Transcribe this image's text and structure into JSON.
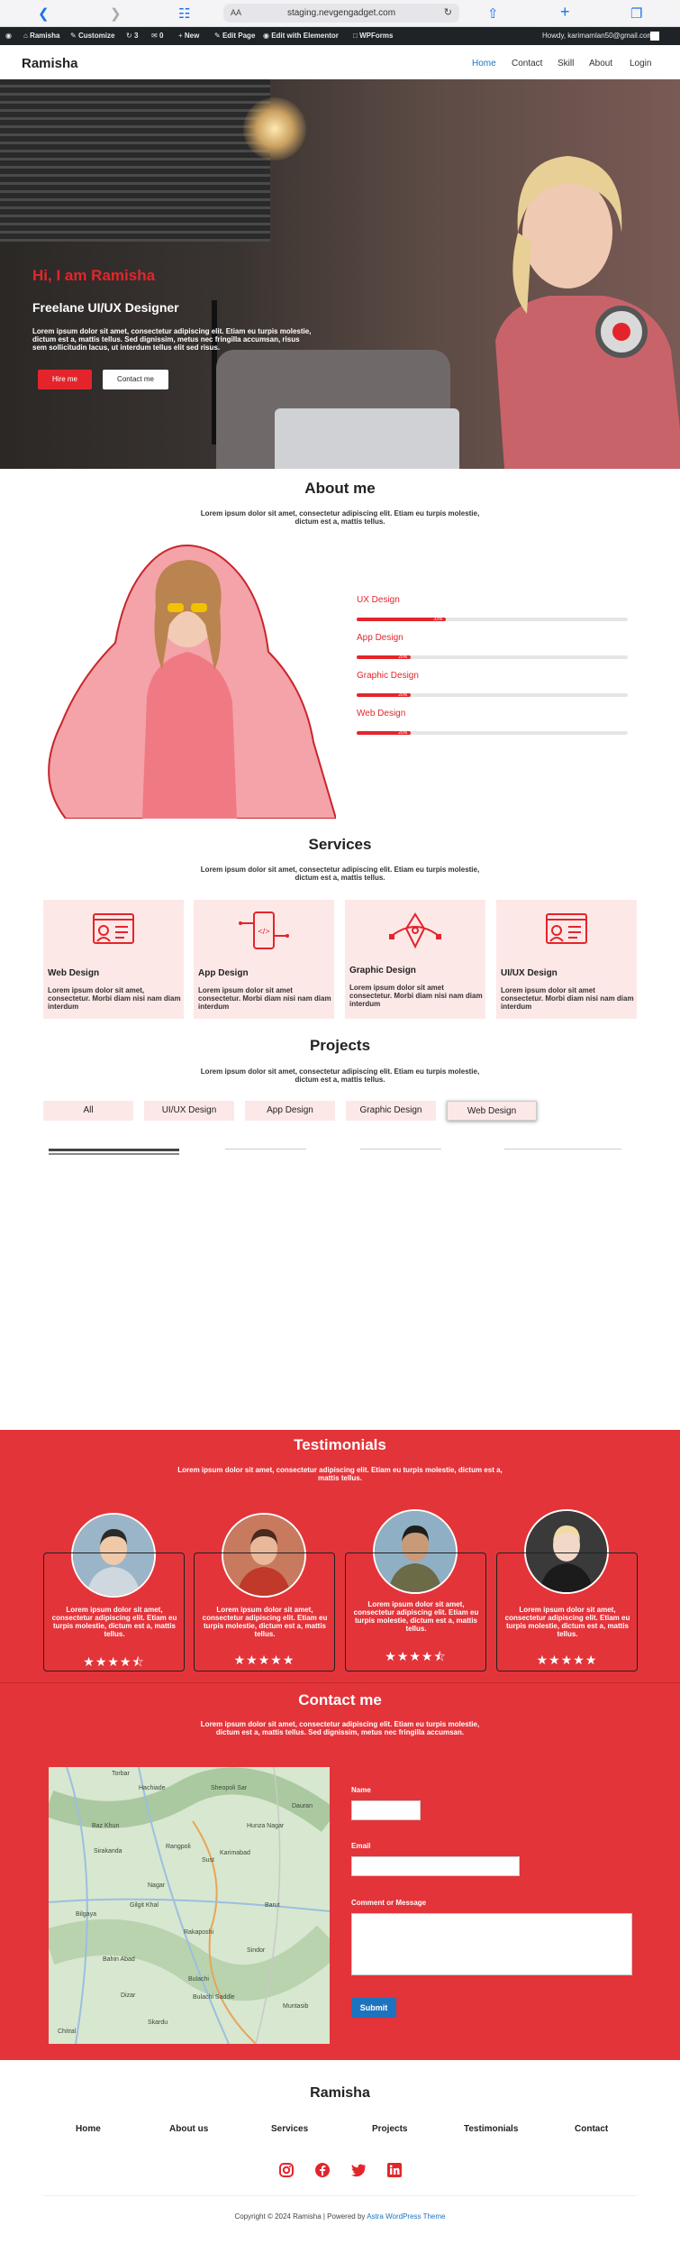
{
  "browser": {
    "url": "staging.nevgengadget.com",
    "aa_label": "AA"
  },
  "admin_bar": {
    "site_name": "Ramisha",
    "customize": "Customize",
    "updates": "3",
    "comments": "0",
    "new": "New",
    "edit_page": "Edit Page",
    "edit_elementor": "Edit with Elementor",
    "wpforms": "WPForms",
    "howdy": "Howdy, karimamlan50@gmail.com"
  },
  "header": {
    "logo": "Ramisha",
    "nav": [
      "Home",
      "Contact",
      "Skill",
      "About",
      "Login"
    ]
  },
  "hero": {
    "greeting": "Hi, I am Ramisha",
    "role": "Freelane UI/UX Designer",
    "description": "Lorem ipsum dolor sit amet, consectetur adipiscing elit. Etiam eu turpis molestie, dictum est a, mattis tellus. Sed dignissim, metus nec fringilla accumsan, risus sem sollicitudin lacus, ut interdum tellus elit sed risus.",
    "hire_button": "Hire me",
    "contact_button": "Contact me"
  },
  "about": {
    "title": "About me",
    "subtitle": "Lorem ipsum dolor sit amet, consectetur adipiscing elit. Etiam eu turpis molestie, dictum est a, mattis tellus.",
    "skills": [
      {
        "label": "UX Design",
        "percent": 33,
        "pct_text": "33%"
      },
      {
        "label": "App Design",
        "percent": 20,
        "pct_text": "20%"
      },
      {
        "label": "Graphic Design",
        "percent": 20,
        "pct_text": "20%"
      },
      {
        "label": "Web Design",
        "percent": 20,
        "pct_text": "20%"
      }
    ]
  },
  "services": {
    "title": "Services",
    "subtitle": "Lorem ipsum dolor sit amet, consectetur adipiscing elit. Etiam eu turpis molestie, dictum est a, mattis tellus.",
    "items": [
      {
        "title": "Web Design",
        "desc": "Lorem ipsum dolor sit amet, consectetur. Morbi diam nisi nam diam interdum",
        "icon": "web-design-icon"
      },
      {
        "title": "App Design",
        "desc": "Lorem ipsum dolor sit amet consectetur. Morbi diam nisi nam diam interdum",
        "icon": "app-design-icon"
      },
      {
        "title": "Graphic Design",
        "desc": "Lorem ipsum dolor sit amet consectetur. Morbi diam nisi nam diam interdum",
        "icon": "pen-tool-icon"
      },
      {
        "title": "UI/UX Design",
        "desc": "Lorem ipsum dolor sit amet consectetur. Morbi diam nisi nam diam interdum",
        "icon": "ui-ux-design-icon"
      }
    ]
  },
  "projects": {
    "title": "Projects",
    "subtitle": "Lorem ipsum dolor sit amet, consectetur adipiscing elit. Etiam eu turpis molestie, dictum est a, mattis tellus.",
    "tabs": [
      "All",
      "UI/UX Design",
      "App Design",
      "Graphic Design",
      "Web Design"
    ],
    "active_tab": "Web Design"
  },
  "testimonials": {
    "title": "Testimonials",
    "subtitle": "Lorem ipsum dolor sit amet, consectetur adipiscing elit. Etiam eu turpis molestie, dictum est a, mattis tellus.",
    "items": [
      {
        "text": "Lorem ipsum dolor sit amet, consectetur adipiscing elit. Etiam eu turpis molestie, dictum est a, mattis tellus.",
        "stars": "★★★★⯪",
        "rating": 4.5
      },
      {
        "text": "Lorem ipsum dolor sit amet, consectetur adipiscing elit. Etiam eu turpis molestie, dictum est a, mattis tellus.",
        "stars": "★★★★★",
        "rating": 5
      },
      {
        "text": "Lorem ipsum dolor sit amet, consectetur adipiscing elit. Etiam eu turpis molestie, dictum est a, mattis tellus.",
        "stars": "★★★★⯪",
        "rating": 4.5
      },
      {
        "text": "Lorem ipsum dolor sit amet, consectetur adipiscing elit. Etiam eu turpis molestie, dictum est a, mattis tellus.",
        "stars": "★★★★★",
        "rating": 5
      }
    ]
  },
  "contact": {
    "title": "Contact me",
    "subtitle": "Lorem ipsum dolor sit amet, consectetur adipiscing elit. Etiam eu turpis molestie, dictum est a, mattis tellus. Sed dignissim, metus nec fringilla accumsan.",
    "map_labels": [
      "Torbar",
      "Hachiade",
      "Sheopoli Sar",
      "Baz Khun",
      "Hunza Nagar",
      "Karimabad",
      "Rakaposhi",
      "Sust",
      "Dauran",
      "Bulachi",
      "Bulachi Saddle",
      "Bahin Abad",
      "Nagar",
      "Muntasib",
      "Skardu",
      "Sirakanda",
      "Gilgit Khal",
      "Chitral",
      "Barut",
      "Rangpoli",
      "Dizar",
      "Sindor",
      "Bilgaya"
    ],
    "name_label": "Name",
    "email_label": "Email",
    "message_label": "Comment or Message",
    "submit": "Submit"
  },
  "footer": {
    "title": "Ramisha",
    "nav": [
      "Home",
      "About us",
      "Services",
      "Projects",
      "Testimonials",
      "Contact"
    ],
    "copyright_prefix": "Copyright © 2024 Ramisha | Powered by ",
    "copyright_link": "Astra WordPress Theme"
  },
  "colors": {
    "accent": "#e3252b",
    "section_red": "#e3343a",
    "card_pink": "#fde8e8",
    "submit_blue": "#1e73be"
  }
}
